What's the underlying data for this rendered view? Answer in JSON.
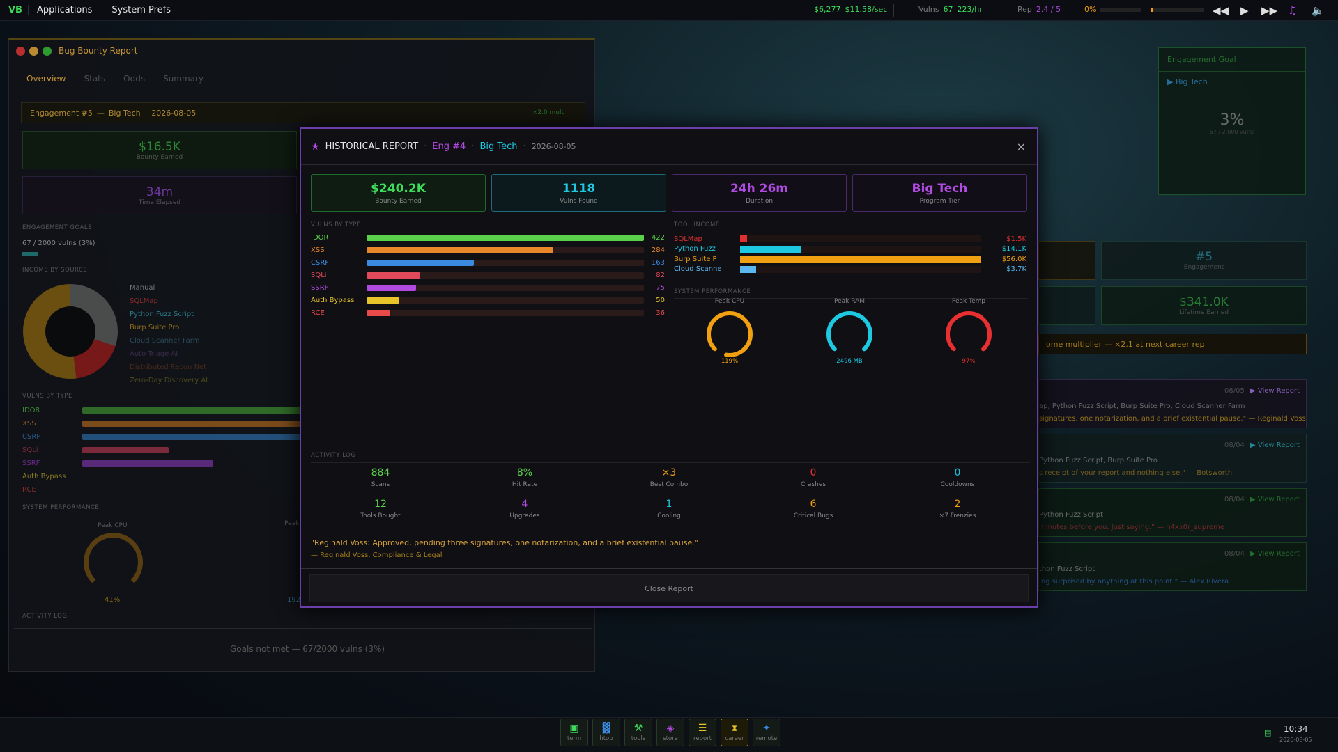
{
  "topbar": {
    "logo": "VB",
    "menus": [
      "Applications",
      "System Prefs"
    ],
    "money": "$6,277",
    "rate": "$11.58/sec",
    "vulns_label": "Vulns",
    "vulns": "67",
    "vulns_rate": "223/hr",
    "rep_label": "Rep",
    "rep": "2.4 / 5",
    "progress": "0%"
  },
  "bgwin": {
    "title": "Bug Bounty Report",
    "tabs": [
      "Overview",
      "Stats",
      "Odds",
      "Summary"
    ],
    "engagement": "Engagement #5",
    "target": "Big Tech",
    "date": "2026-08-05",
    "mult": "×2.0 mult",
    "bounty": "$16.5K",
    "bounty_label": "Bounty Earned",
    "time": "34m",
    "time_label": "Time Elapsed",
    "goals_label": "ENGAGEMENT GOALS",
    "goals_text": "67 / 2000 vulns  (3%)",
    "income_label": "INCOME BY SOURCE",
    "income_sources": [
      "Manual",
      "SQLMap",
      "Python Fuzz Script",
      "Burp Suite Pro",
      "Cloud Scanner Farm",
      "Auto-Triage AI",
      "Distributed Recon Net",
      "Zero-Day Discovery AI"
    ],
    "vulns_label": "VULNS BY TYPE",
    "vtypes": [
      "IDOR",
      "XSS",
      "CSRF",
      "SQLi",
      "SSRF",
      "Auth Bypass",
      "RCE"
    ],
    "perf_label": "SYSTEM PERFORMANCE",
    "cpu_label": "Peak CPU",
    "cpu": "41%",
    "ram_label": "Peak",
    "ram": "192",
    "log_label": "ACTIVITY LOG",
    "goal_fail": "Goals not met — 67/2000 vulns (3%)"
  },
  "right": {
    "goal_title": "Engagement Goal",
    "goal_target": "▶ Big Tech",
    "goal_pct": "3%",
    "goal_sub": "67 / 2,000 vulns",
    "eng_num": "#5",
    "eng_label": "Engagement",
    "lifetime": "$341.0K",
    "lifetime_label": "Lifetime Earned",
    "mult_text": "ome multiplier — ×2.1 at next career rep",
    "reports": [
      {
        "date": "08/05",
        "link": "▶ View Report",
        "l1": "ap, Python Fuzz Script, Burp Suite Pro, Cloud Scanner Farm",
        "l2": "signatures, one notarization, and a brief existential pause.\" — Reginald Voss"
      },
      {
        "date": "08/04",
        "link": "▶ View Report",
        "l1": "Python Fuzz Script, Burp Suite Pro",
        "l2": "s receipt of your report and nothing else.\" — Botsworth"
      },
      {
        "date": "08/04",
        "link": "▶ View Report",
        "l1": "Python Fuzz Script",
        "l2": "minutes before you. Just saying.\" — h4xx0r_supreme"
      },
      {
        "date": "08/04",
        "link": "▶ View Report",
        "l1": "thon Fuzz Script",
        "l2": "ing surprised by anything at this point.\" — Alex Rivera"
      }
    ]
  },
  "modal": {
    "title": "HISTORICAL REPORT",
    "eng": "Eng #4",
    "target": "Big Tech",
    "date": "2026-08-05",
    "close": "×",
    "cards": [
      {
        "v": "$240.2K",
        "l": "Bounty Earned"
      },
      {
        "v": "1118",
        "l": "Vulns Found"
      },
      {
        "v": "24h 26m",
        "l": "Duration"
      },
      {
        "v": "Big Tech",
        "l": "Program Tier"
      }
    ],
    "vulns_label": "VULNS BY TYPE",
    "vulns": [
      {
        "n": "IDOR",
        "v": 422,
        "c": "#5ad14a"
      },
      {
        "n": "XSS",
        "v": 284,
        "c": "#e8872a"
      },
      {
        "n": "CSRF",
        "v": 163,
        "c": "#3a8ae0"
      },
      {
        "n": "SQLi",
        "v": 82,
        "c": "#e04a5a"
      },
      {
        "n": "SSRF",
        "v": 75,
        "c": "#b04ae0"
      },
      {
        "n": "Auth Bypass",
        "v": 50,
        "c": "#e6c42a"
      },
      {
        "n": "RCE",
        "v": 36,
        "c": "#e84a4a"
      }
    ],
    "tools_label": "TOOL INCOME",
    "tools": [
      {
        "n": "SQLMap",
        "v": "$1.5K",
        "f": 0.027,
        "c": "#e03030"
      },
      {
        "n": "Python Fuzz",
        "v": "$14.1K",
        "f": 0.252,
        "c": "#1ec8e0"
      },
      {
        "n": "Burp Suite P",
        "v": "$56.0K",
        "f": 1.0,
        "c": "#f0a010"
      },
      {
        "n": "Cloud Scanne",
        "v": "$3.7K",
        "f": 0.066,
        "c": "#5ab8f0"
      }
    ],
    "perf_label": "SYSTEM PERFORMANCE",
    "gauges": [
      {
        "l": "Peak CPU",
        "v": "119%",
        "c": "#f0a010",
        "f": 0.9
      },
      {
        "l": "Peak RAM",
        "v": "2496 MB",
        "c": "#1ec8e0",
        "f": 0.75
      },
      {
        "l": "Peak Temp",
        "v": "97%",
        "c": "#e83030",
        "f": 0.75
      }
    ],
    "log_label": "ACTIVITY LOG",
    "stats": [
      {
        "v": "884",
        "l": "Scans",
        "c": "#5ad14a"
      },
      {
        "v": "8%",
        "l": "Hit Rate",
        "c": "#5ad14a"
      },
      {
        "v": "×3",
        "l": "Best Combo",
        "c": "#f0a010"
      },
      {
        "v": "0",
        "l": "Crashes",
        "c": "#e83030"
      },
      {
        "v": "0",
        "l": "Cooldowns",
        "c": "#1ec8e0"
      },
      {
        "v": "12",
        "l": "Tools Bought",
        "c": "#5ad14a"
      },
      {
        "v": "4",
        "l": "Upgrades",
        "c": "#b04ae0"
      },
      {
        "v": "1",
        "l": "Cooling",
        "c": "#1ec8e0"
      },
      {
        "v": "6",
        "l": "Critical Bugs",
        "c": "#f0a010"
      },
      {
        "v": "2",
        "l": "×7 Frenzies",
        "c": "#f0a010"
      }
    ],
    "quote": "\"Reginald Voss: Approved, pending three signatures, one notarization, and a brief existential pause.\"",
    "quote_by": "— Reginald Voss, Compliance & Legal",
    "close_btn": "Close Report"
  },
  "taskbar": {
    "items": [
      {
        "l": "term",
        "i": "▣"
      },
      {
        "l": "htop",
        "i": "▓"
      },
      {
        "l": "tools",
        "i": "⚒"
      },
      {
        "l": "store",
        "i": "◈"
      },
      {
        "l": "report",
        "i": "☰"
      },
      {
        "l": "career",
        "i": "⧗"
      },
      {
        "l": "remote",
        "i": "✦"
      }
    ],
    "time": "10:34",
    "date": "2026-08-05"
  },
  "colors": {
    "accent": "#6b3fa8",
    "green": "#3ddc5a",
    "gold": "#d8a23a"
  }
}
